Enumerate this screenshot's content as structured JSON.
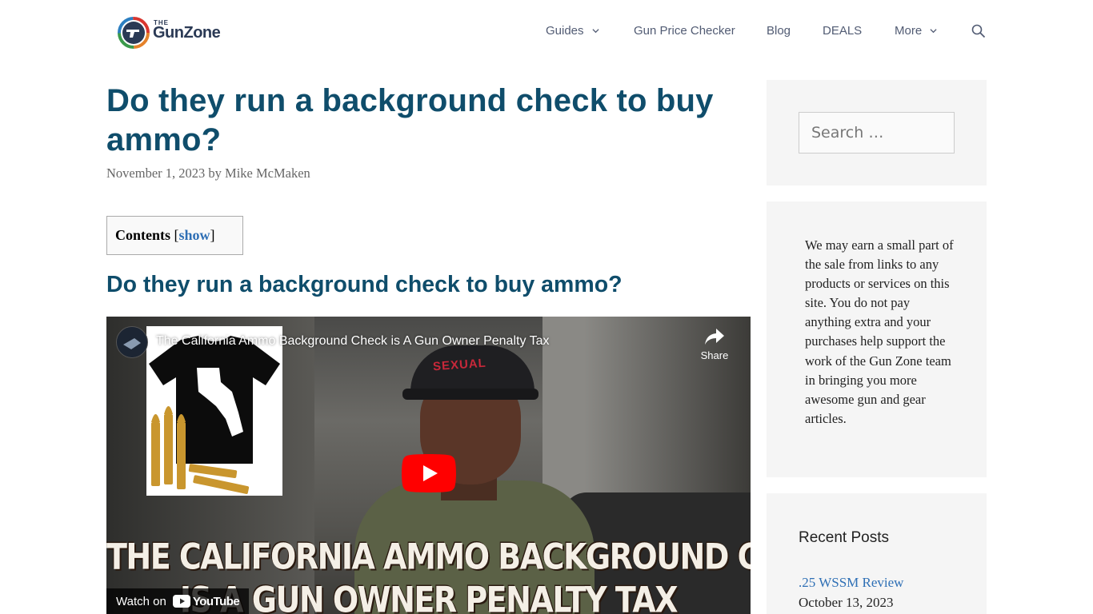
{
  "header": {
    "logo": {
      "small": "THE",
      "name": "GunZone"
    },
    "nav": [
      {
        "label": "Guides"
      },
      {
        "label": "Gun Price Checker"
      },
      {
        "label": "Blog"
      },
      {
        "label": "DEALS"
      },
      {
        "label": "More"
      }
    ]
  },
  "article": {
    "title": "Do they run a background check to buy ammo?",
    "date": "November 1, 2023",
    "by": "by",
    "author": "Mike McMaken",
    "toc": {
      "title": "Contents",
      "open_bracket": "[",
      "toggle": "show",
      "close_bracket": "]"
    },
    "section_heading": "Do they run a background check to buy ammo?"
  },
  "video": {
    "title": "The California Ammo Background Check is A Gun Owner Penalty Tax",
    "share_label": "Share",
    "cap_text": "SEXUAL",
    "overlay_line1": "THE CALIFORNIA AMMO BACKGROUND CHECK",
    "overlay_line2": "IS A GUN OWNER PENALTY TAX",
    "watch_on": "Watch on",
    "youtube": "YouTube"
  },
  "sidebar": {
    "search_placeholder": "Search …",
    "disclosure": "We may earn a small part of the sale from links to any products or services on this site. You do not pay anything extra and your purchases help support the work of the Gun Zone team in bringing you more awesome gun and gear articles.",
    "recent_posts": {
      "title": "Recent Posts",
      "items": [
        {
          "label": ".25 WSSM Review",
          "date": "October 13, 2023"
        }
      ]
    }
  },
  "colors": {
    "heading": "#0f4d6b",
    "nav_text": "#515b73",
    "link": "#2e6fb5",
    "widget_bg": "#f5f5f5",
    "youtube_red": "#ff0000"
  },
  "icons": [
    "gunzone-logo-icon",
    "chevron-down-icon",
    "search-icon",
    "share-arrow-icon",
    "play-icon",
    "youtube-icon"
  ]
}
